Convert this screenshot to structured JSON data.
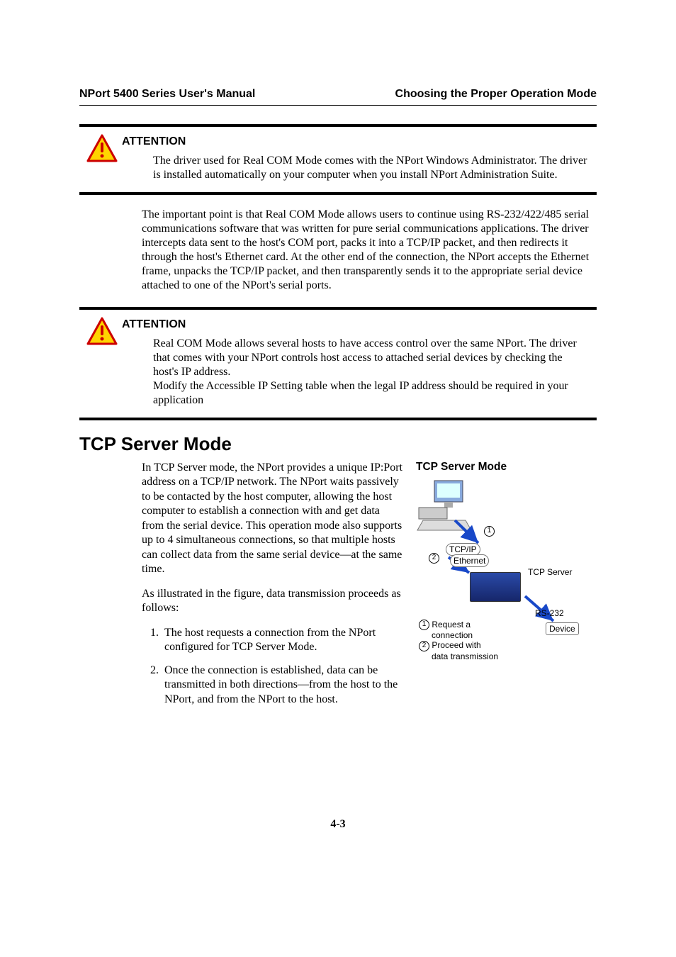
{
  "header": {
    "left": "NPort 5400 Series User's Manual",
    "right": "Choosing the Proper Operation Mode"
  },
  "callouts": [
    {
      "title": "ATTENTION",
      "text": "The driver used for Real COM Mode comes with the NPort Windows Administrator. The driver is installed automatically on your computer when you install NPort Administration Suite."
    },
    {
      "title": "ATTENTION",
      "text_line1": "Real COM Mode allows several hosts to have access control over the same NPort. The driver that comes with your NPort controls host access to attached serial devices by checking the host's IP address.",
      "text_line2": "Modify the Accessible IP Setting table when the legal IP address should be required in your application"
    }
  ],
  "middle_para": "The important point is that Real COM Mode allows users to continue using RS-232/422/485 serial communications software that was written for pure serial communications applications. The driver intercepts data sent to the host's COM port, packs it into a TCP/IP packet, and then redirects it through the host's Ethernet card. At the other end of the connection, the NPort accepts the Ethernet frame, unpacks the TCP/IP packet, and then transparently sends it to the appropriate serial device attached to one of the NPort's serial ports.",
  "section": {
    "heading": "TCP Server Mode",
    "para1": "In TCP Server mode, the NPort provides a unique IP:Port address on a TCP/IP network. The NPort waits passively to be contacted by the host computer, allowing the host computer to establish a connection with and get data from the serial device. This operation mode also supports up to 4 simultaneous connections, so that multiple hosts can collect data from the same serial device—at the same time.",
    "para2": "As illustrated in the figure, data transmission proceeds as follows:",
    "list": [
      "The host requests a connection from the NPort configured for TCP Server Mode.",
      "Once the connection is established, data can be transmitted in both directions—from the host to the NPort, and from the NPort to the host."
    ]
  },
  "figure": {
    "title": "TCP Server Mode",
    "labels": {
      "tcp_server": "TCP Server",
      "rs232": "RS-232",
      "device": "Device",
      "tcpip": "TCP/IP",
      "ethernet": "Ethernet",
      "step1a": "Request a",
      "step1b": "connection",
      "step2a": "Proceed with",
      "step2b": "data transmission",
      "badge1": "1",
      "badge2": "2"
    }
  },
  "page_number": "4-3"
}
